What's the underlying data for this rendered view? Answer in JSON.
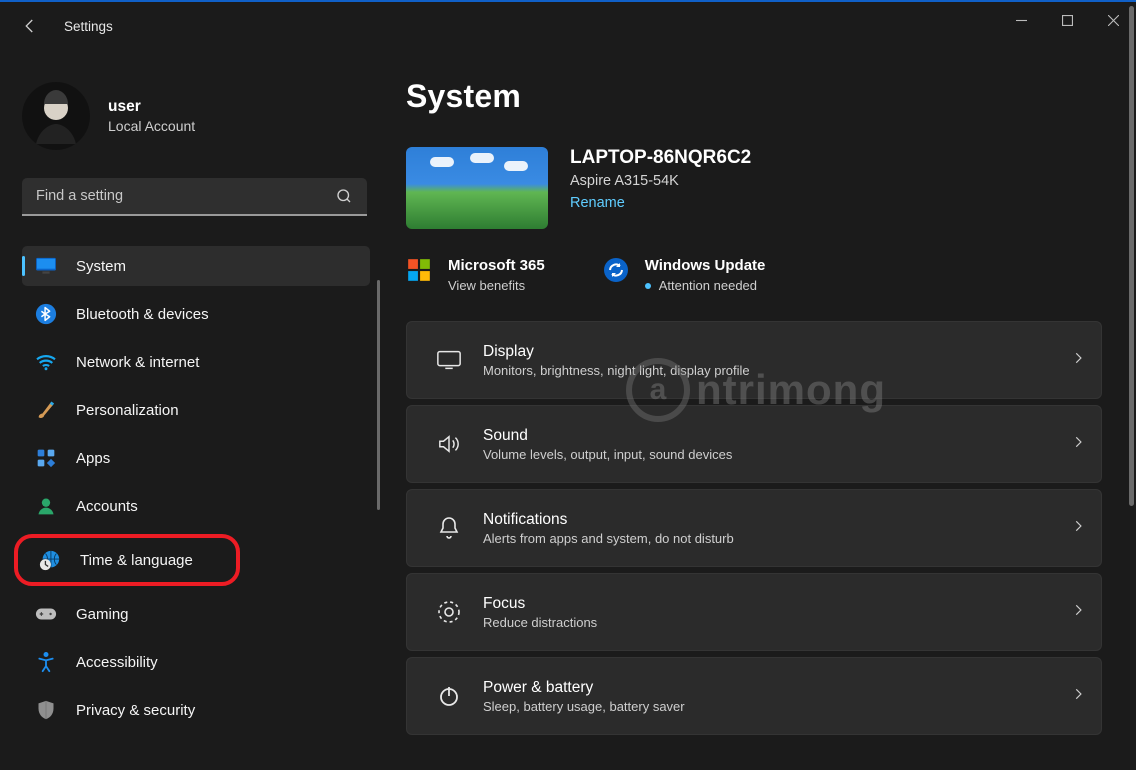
{
  "header": {
    "title": "Settings"
  },
  "user": {
    "name": "user",
    "type": "Local Account"
  },
  "search": {
    "placeholder": "Find a setting"
  },
  "nav": {
    "system": "System",
    "bluetooth": "Bluetooth & devices",
    "network": "Network & internet",
    "personalization": "Personalization",
    "apps": "Apps",
    "accounts": "Accounts",
    "time": "Time & language",
    "gaming": "Gaming",
    "accessibility": "Accessibility",
    "privacy": "Privacy & security"
  },
  "page": {
    "title": "System",
    "device": {
      "name": "LAPTOP-86NQR6C2",
      "model": "Aspire A315-54K",
      "rename": "Rename"
    },
    "m365": {
      "title": "Microsoft 365",
      "sub": "View benefits"
    },
    "update": {
      "title": "Windows Update",
      "sub": "Attention needed"
    },
    "cards": {
      "display": {
        "t": "Display",
        "d": "Monitors, brightness, night light, display profile"
      },
      "sound": {
        "t": "Sound",
        "d": "Volume levels, output, input, sound devices"
      },
      "notifications": {
        "t": "Notifications",
        "d": "Alerts from apps and system, do not disturb"
      },
      "focus": {
        "t": "Focus",
        "d": "Reduce distractions"
      },
      "power": {
        "t": "Power & battery",
        "d": "Sleep, battery usage, battery saver"
      }
    }
  },
  "watermark": "ntrimong"
}
